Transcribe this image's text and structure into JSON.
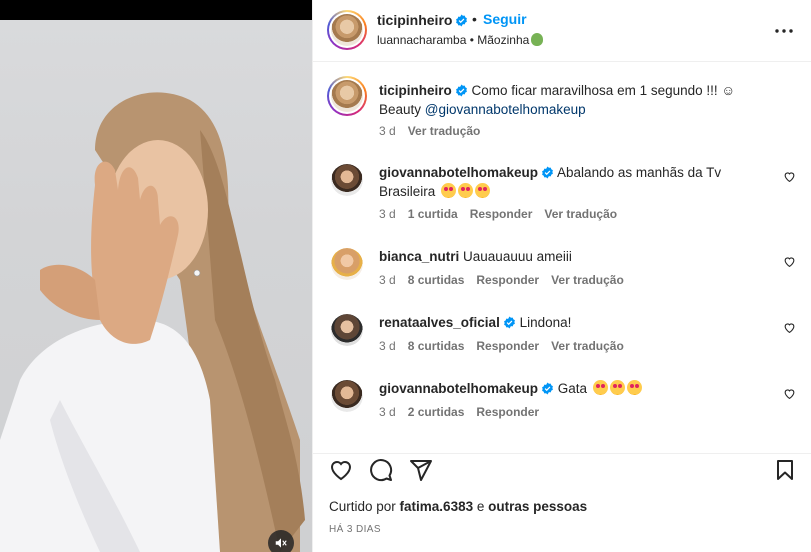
{
  "header": {
    "username": "ticipinheiro",
    "dot": "•",
    "follow_label": "Seguir",
    "subtitle": "luannacharamba • Mãozinha"
  },
  "caption": {
    "username": "ticipinheiro",
    "text": " Como ficar maravilhosa em 1 segundo !!! ☺",
    "text2": "Beauty ",
    "mention": "@giovannabotelhomakeup",
    "time": "3 d",
    "translate_label": "Ver tradução"
  },
  "comments": [
    {
      "username": "giovannabotelhomakeup",
      "verified": true,
      "text": " Abalando as manhãs da Tv Brasileira ",
      "emoji_count": 3,
      "time": "3 d",
      "likes": "1 curtida",
      "reply_label": "Responder",
      "translate_label": "Ver tradução"
    },
    {
      "username": "bianca_nutri",
      "verified": false,
      "text": " Uauauauuu ameiii",
      "emoji_count": 0,
      "time": "3 d",
      "likes": "8 curtidas",
      "reply_label": "Responder",
      "translate_label": "Ver tradução"
    },
    {
      "username": "renataalves_oficial",
      "verified": true,
      "text": " Lindona!",
      "emoji_count": 0,
      "time": "3 d",
      "likes": "8 curtidas",
      "reply_label": "Responder",
      "translate_label": "Ver tradução"
    },
    {
      "username": "giovannabotelhomakeup",
      "verified": true,
      "text": " Gata ",
      "emoji_count": 3,
      "time": "3 d",
      "likes": "2 curtidas",
      "reply_label": "Responder",
      "translate_label": ""
    }
  ],
  "actions": {
    "icons": [
      "heart-icon",
      "comment-icon",
      "share-icon",
      "bookmark-icon"
    ],
    "liked_prefix": "Curtido por ",
    "liked_user": "fatima.6383",
    "liked_middle": " e ",
    "liked_suffix": "outras pessoas",
    "time_ago": "HÁ 3 DIAS"
  },
  "colors": {
    "link_blue": "#0095f6",
    "mention_blue": "#00376b",
    "secondary_text": "#737373",
    "verified_blue": "#0095f6"
  }
}
